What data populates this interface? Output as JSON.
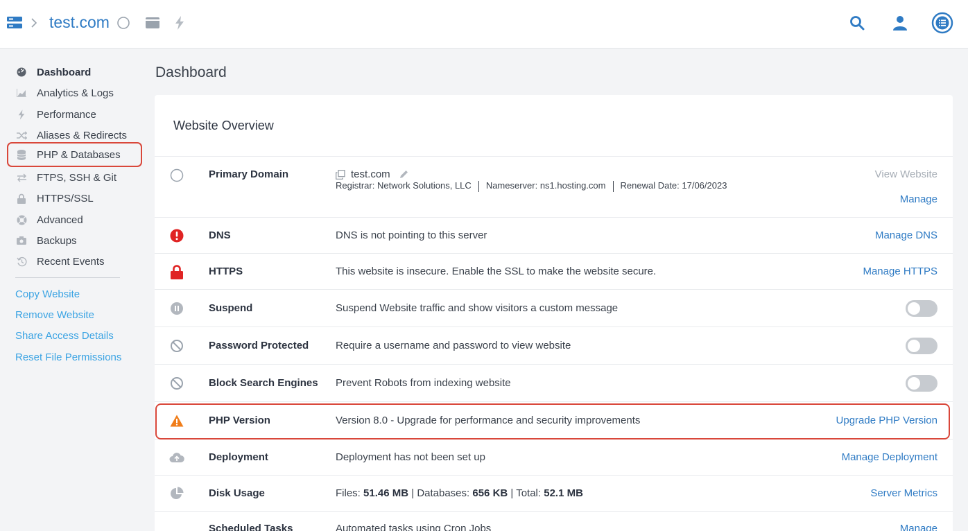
{
  "topbar": {
    "site_name": "test.com"
  },
  "sidebar": {
    "nav": [
      {
        "label": "Dashboard",
        "icon": "dashboard-icon"
      },
      {
        "label": "Analytics & Logs",
        "icon": "chart-icon"
      },
      {
        "label": "Performance",
        "icon": "bolt-icon"
      },
      {
        "label": "Aliases & Redirects",
        "icon": "shuffle-icon"
      },
      {
        "label": "PHP & Databases",
        "icon": "database-icon"
      },
      {
        "label": "FTPS, SSH & Git",
        "icon": "transfer-icon"
      },
      {
        "label": "HTTPS/SSL",
        "icon": "lock-icon"
      },
      {
        "label": "Advanced",
        "icon": "lifebuoy-icon"
      },
      {
        "label": "Backups",
        "icon": "camera-icon"
      },
      {
        "label": "Recent Events",
        "icon": "history-icon"
      }
    ],
    "links": [
      "Copy Website",
      "Remove Website",
      "Share Access Details",
      "Reset File Permissions"
    ]
  },
  "main": {
    "page_title": "Dashboard",
    "card_title": "Website Overview",
    "primary_domain": {
      "name": "Primary Domain",
      "domain": "test.com",
      "registrar": "Registrar: Network Solutions, LLC",
      "nameserver": "Nameserver: ns1.hosting.com",
      "renewal": "Renewal Date: 17/06/2023",
      "action_view": "View Website",
      "action_manage": "Manage"
    },
    "rows": [
      {
        "name": "DNS",
        "desc": "DNS is not pointing to this server",
        "action": "Manage DNS"
      },
      {
        "name": "HTTPS",
        "desc": "This website is insecure. Enable the SSL to make the website secure.",
        "action": "Manage HTTPS"
      },
      {
        "name": "Suspend",
        "desc": "Suspend Website traffic and show visitors a custom message",
        "toggle": false
      },
      {
        "name": "Password Protected",
        "desc": "Require a username and password to view website",
        "toggle": false
      },
      {
        "name": "Block Search Engines",
        "desc": "Prevent Robots from indexing website",
        "toggle": false
      },
      {
        "name": "PHP Version",
        "desc": "Version 8.0 - Upgrade for performance and security improvements",
        "action": "Upgrade PHP Version"
      },
      {
        "name": "Deployment",
        "desc": "Deployment has not been set up",
        "action": "Manage Deployment"
      },
      {
        "name": "Disk Usage",
        "action": "Server Metrics"
      },
      {
        "name": "Scheduled Tasks",
        "desc": "Automated tasks using Cron Jobs",
        "action": "Manage"
      }
    ],
    "disk": {
      "files_label": "Files:",
      "files_value": "51.46 MB",
      "db_label": "Databases:",
      "db_value": "656 KB",
      "total_label": "Total:",
      "total_value": "52.1 MB"
    }
  },
  "colors": {
    "accent": "#2f7bc4",
    "link": "#3aa3e3",
    "error": "#e02424",
    "warning": "#f07d1a",
    "highlight": "#d9473a"
  }
}
